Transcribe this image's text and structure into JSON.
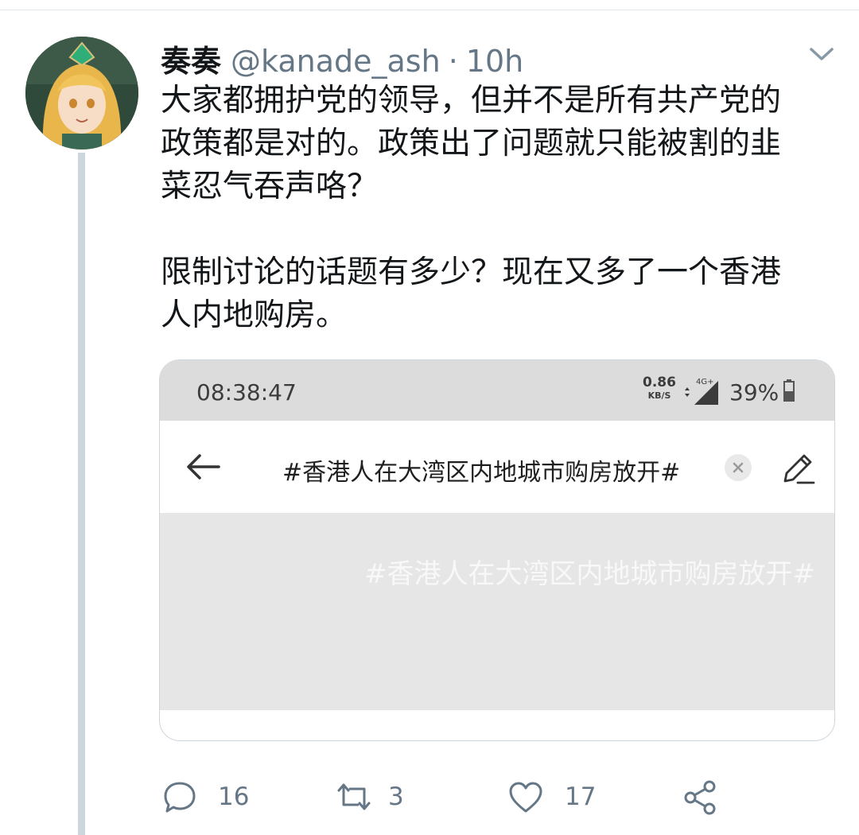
{
  "tweet": {
    "display_name": "奏奏",
    "handle": "@kanade_ash",
    "separator": "·",
    "time": "10h",
    "text": "大家都拥护党的领导，但并不是所有共产党的\n政策都是对的。政策出了问题就只能被割的韭\n菜忍气吞声咯？\n\n限制讨论的话题有多少？现在又多了一个香港\n人内地购房。"
  },
  "media": {
    "status_bar": {
      "time": "08:38:47",
      "net_speed_value": "0.86",
      "net_speed_unit": "KB/S",
      "network_label": "4G+",
      "battery": "39%"
    },
    "search_query": "#香港人在大湾区内地城市购房放开#",
    "banner_text": "#香港人在大湾区内地城市购房放开#"
  },
  "actions": {
    "replies": "16",
    "retweets": "3",
    "likes": "17"
  },
  "colors": {
    "text": "#14171a",
    "muted": "#657786",
    "thread_line": "#ccd6dd"
  }
}
